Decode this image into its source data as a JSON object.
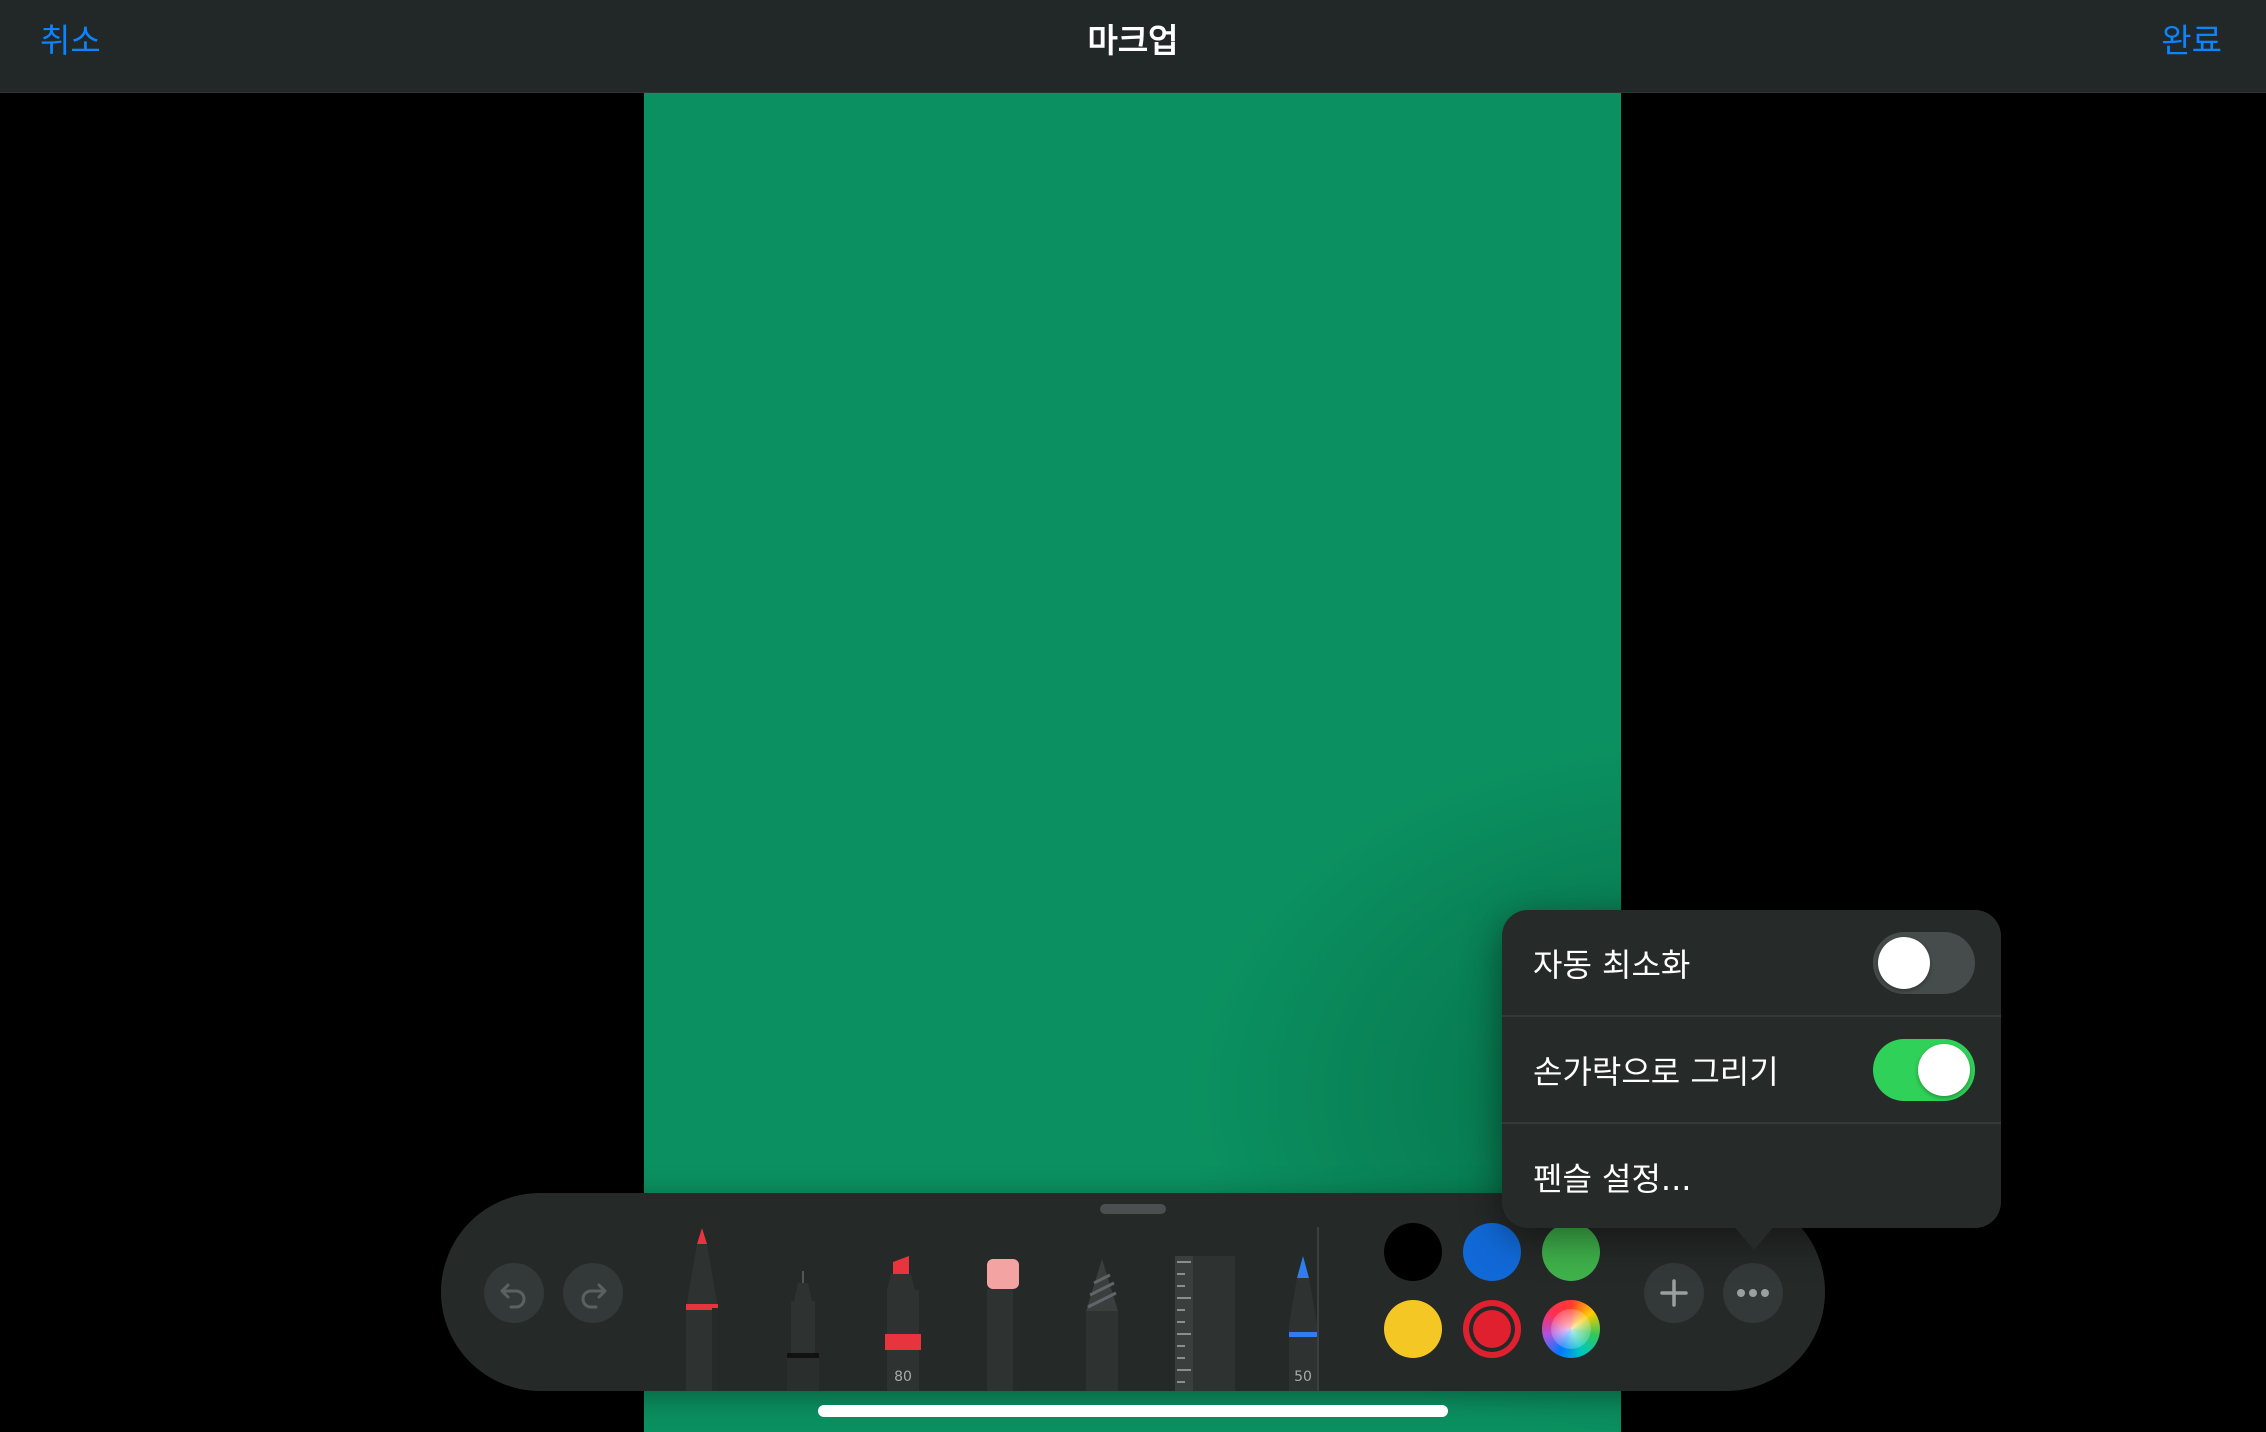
{
  "navbar": {
    "cancel_label": "취소",
    "title": "마크업",
    "done_label": "완료"
  },
  "palette": {
    "tools": [
      {
        "name": "pen",
        "label": ""
      },
      {
        "name": "fineliner",
        "label": ""
      },
      {
        "name": "marker",
        "label": "80"
      },
      {
        "name": "eraser",
        "label": ""
      },
      {
        "name": "lasso",
        "label": ""
      },
      {
        "name": "ruler",
        "label": ""
      },
      {
        "name": "pencil",
        "label": "50"
      }
    ],
    "colors": [
      "#000000",
      "#1169d8",
      "#3fb24b",
      "#f4c725",
      "#e0202f",
      "multicolor"
    ],
    "selected_color": "#e0202f",
    "icons": [
      "undo-icon",
      "redo-icon",
      "plus-icon",
      "more-icon"
    ]
  },
  "popover": {
    "auto_minimize_label": "자동 최소화",
    "auto_minimize_on": false,
    "draw_with_finger_label": "손가락으로 그리기",
    "draw_with_finger_on": true,
    "pencil_settings_label": "펜슬 설정..."
  }
}
